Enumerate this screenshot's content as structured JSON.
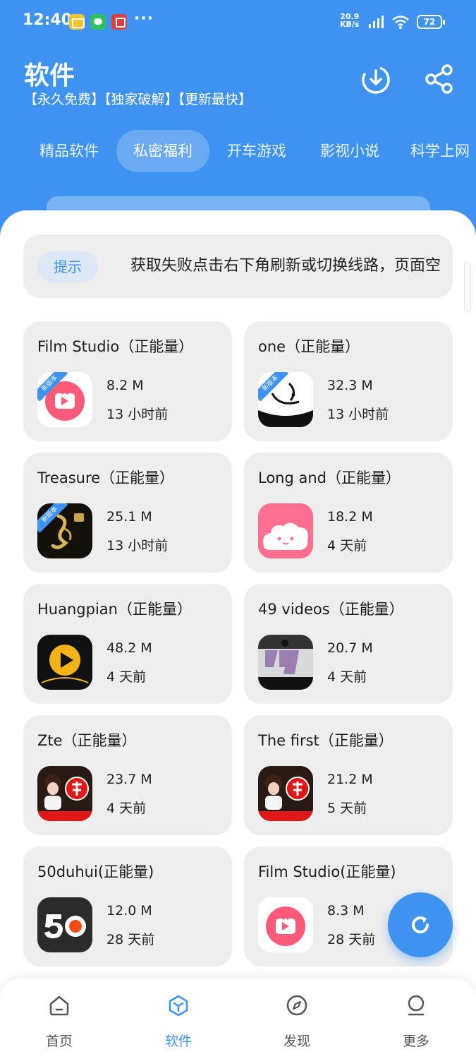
{
  "status_bar": {
    "time": "12:40",
    "net_speed_value": "20.9",
    "net_speed_unit": "KB/s",
    "battery": "72"
  },
  "header": {
    "title": "软件",
    "subtitle": "【永久免费】【独家破解】【更新最快】"
  },
  "tabs": [
    {
      "label": "精品软件",
      "active": false
    },
    {
      "label": "私密福利",
      "active": true
    },
    {
      "label": "开车游戏",
      "active": false
    },
    {
      "label": "影视小说",
      "active": false
    },
    {
      "label": "科学上网",
      "active": false
    }
  ],
  "notice": {
    "tag": "提示",
    "text": "获取失败点击右下角刷新或切换线路，页面空"
  },
  "apps": [
    {
      "title": "Film Studio（正能量）",
      "size": "8.2 M",
      "time": "13 小时前",
      "badge": "新版本",
      "icon": "tv-icon",
      "color": "#ff5a7a"
    },
    {
      "title": "one（正能量）",
      "size": "32.3 M",
      "time": "13 小时前",
      "badge": "新版本",
      "icon": "moon-face-icon",
      "color": "#111111"
    },
    {
      "title": "Treasure（正能量）",
      "size": "25.1 M",
      "time": "13 小时前",
      "badge": "新版本",
      "icon": "golden-dancer-icon",
      "color": "#c9a24a"
    },
    {
      "title": "Long and（正能量）",
      "size": "18.2 M",
      "time": "4 天前",
      "badge": "",
      "icon": "cloud-face-icon",
      "color": "#ff6f8f"
    },
    {
      "title": "Huangpian（正能量）",
      "size": "48.2 M",
      "time": "4 天前",
      "badge": "",
      "icon": "play-orb-icon",
      "color": "#f3b316"
    },
    {
      "title": "49 videos（正能量）",
      "size": "20.7 M",
      "time": "4 天前",
      "badge": "",
      "icon": "number-49-icon",
      "color": "#9c7fb0"
    },
    {
      "title": "Zte（正能量）",
      "size": "23.7 M",
      "time": "4 天前",
      "badge": "",
      "icon": "te-badge-icon",
      "color": "#e01818"
    },
    {
      "title": "The first（正能量）",
      "size": "21.2 M",
      "time": "5 天前",
      "badge": "",
      "icon": "te-badge-icon",
      "color": "#e01818"
    },
    {
      "title": "50duhui(正能量)",
      "size": "12.0 M",
      "time": "28 天前",
      "badge": "",
      "icon": "number-50-icon",
      "color": "#ff4a1a"
    },
    {
      "title": "Film Studio(正能量)",
      "size": "8.3 M",
      "time": "28 天前",
      "badge": "",
      "icon": "tv-icon",
      "color": "#ff5a7a"
    }
  ],
  "bottom_nav": [
    {
      "label": "首页",
      "icon": "home-icon",
      "active": false
    },
    {
      "label": "软件",
      "icon": "cube-icon",
      "active": true
    },
    {
      "label": "发现",
      "icon": "compass-icon",
      "active": false
    },
    {
      "label": "更多",
      "icon": "user-icon",
      "active": false
    }
  ],
  "colors": {
    "accent": "#3f93f0",
    "card_bg": "#eeeeee"
  }
}
